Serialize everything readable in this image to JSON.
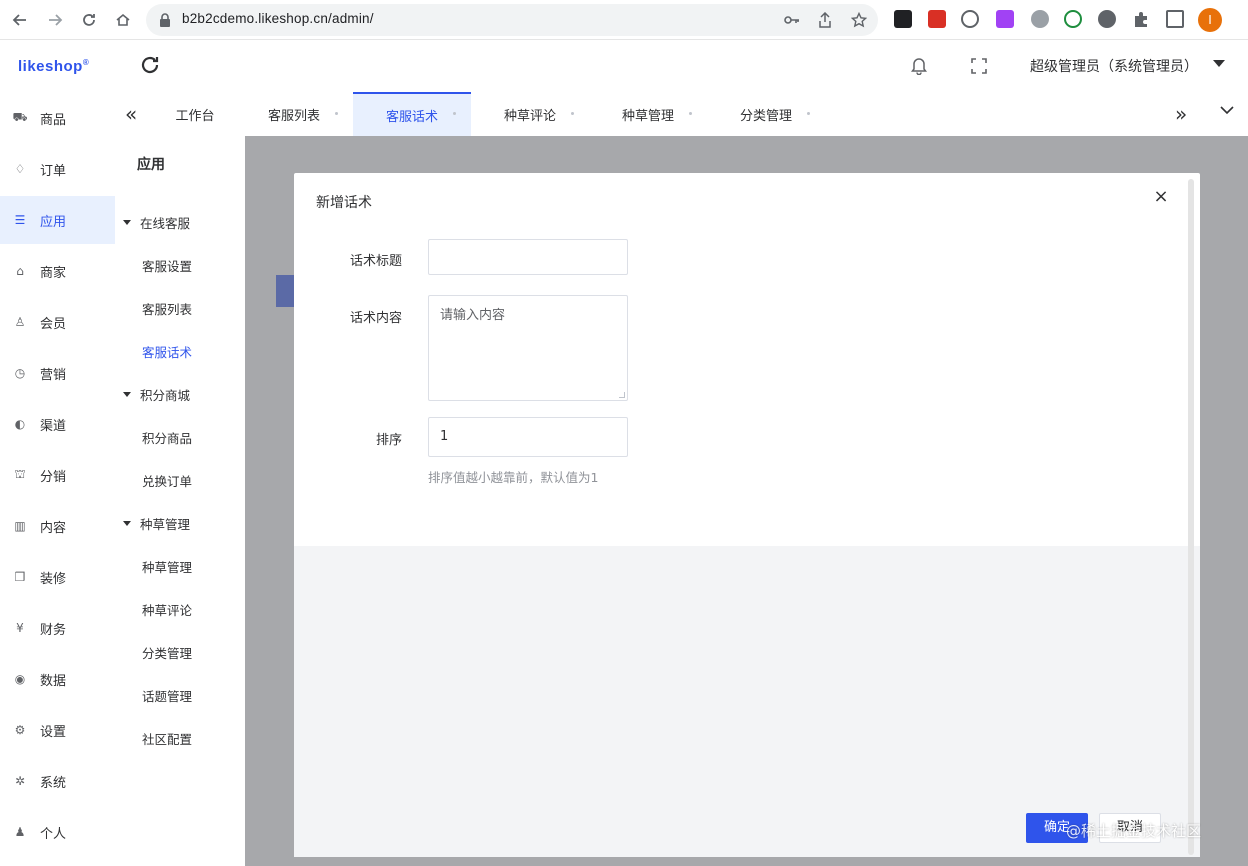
{
  "browser": {
    "url": "b2b2cdemo.likeshop.cn/admin/",
    "profile_initial": "I"
  },
  "header": {
    "logo": "likeshop",
    "logo_mark": "®",
    "admin_name": "超级管理员（系统管理员）"
  },
  "sidebar": {
    "items": [
      {
        "icon": "cart-icon",
        "glyph": "⛟",
        "label": "商品"
      },
      {
        "icon": "bell-icon",
        "glyph": "♢",
        "label": "订单"
      },
      {
        "icon": "app-icon",
        "glyph": "☰",
        "label": "应用"
      },
      {
        "icon": "shop-icon",
        "glyph": "⌂",
        "label": "商家"
      },
      {
        "icon": "user-icon",
        "glyph": "♙",
        "label": "会员"
      },
      {
        "icon": "marketing-icon",
        "glyph": "◷",
        "label": "营销"
      },
      {
        "icon": "channel-icon",
        "glyph": "◐",
        "label": "渠道"
      },
      {
        "icon": "distribution-icon",
        "glyph": "⛫",
        "label": "分销"
      },
      {
        "icon": "content-icon",
        "glyph": "▥",
        "label": "内容"
      },
      {
        "icon": "decorate-icon",
        "glyph": "❒",
        "label": "装修"
      },
      {
        "icon": "finance-icon",
        "glyph": "¥",
        "label": "财务"
      },
      {
        "icon": "data-icon",
        "glyph": "◉",
        "label": "数据"
      },
      {
        "icon": "settings-icon",
        "glyph": "⚙",
        "label": "设置"
      },
      {
        "icon": "system-icon",
        "glyph": "✲",
        "label": "系统"
      },
      {
        "icon": "person-icon",
        "glyph": "♟",
        "label": "个人"
      }
    ],
    "active_index": 2
  },
  "tabs": {
    "items": [
      "工作台",
      "客服列表",
      "客服话术",
      "种草评论",
      "种草管理",
      "分类管理"
    ],
    "active_index": 2
  },
  "subnav": {
    "title": "应用",
    "groups": [
      {
        "label": "在线客服",
        "items": [
          "客服设置",
          "客服列表",
          "客服话术"
        ]
      },
      {
        "label": "积分商城",
        "items": [
          "积分商品",
          "兑换订单"
        ]
      },
      {
        "label": "种草管理",
        "items": [
          "种草管理",
          "种草评论",
          "分类管理",
          "话题管理",
          "社区配置"
        ]
      }
    ],
    "active_item": "客服话术"
  },
  "dialog": {
    "title": "新增话术",
    "close_glyph": "×",
    "fields": {
      "title_label": "话术标题",
      "title_value": "",
      "content_label": "话术内容",
      "content_placeholder": "请输入内容",
      "sort_label": "排序",
      "sort_value": "1",
      "sort_hint": "排序值越小越靠前，默认值为1"
    },
    "confirm_label": "确定",
    "cancel_label": "取消"
  },
  "watermark": "@稀土掘金技术社区",
  "colors": {
    "primary": "#2f54eb",
    "active_bg": "#e8f0fe",
    "overlay": "rgba(120,120,125,0.62)"
  }
}
